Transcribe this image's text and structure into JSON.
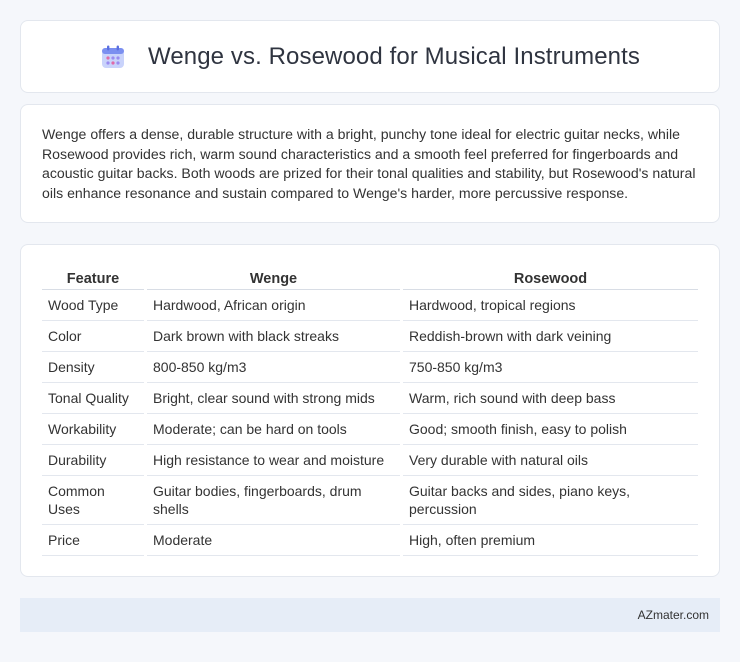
{
  "header": {
    "title": "Wenge vs. Rosewood for Musical Instruments",
    "icon": "calendar-icon"
  },
  "intro": {
    "text": "Wenge offers a dense, durable structure with a bright, punchy tone ideal for electric guitar necks, while Rosewood provides rich, warm sound characteristics and a smooth feel preferred for fingerboards and acoustic guitar backs. Both woods are prized for their tonal qualities and stability, but Rosewood's natural oils enhance resonance and sustain compared to Wenge's harder, more percussive response."
  },
  "table": {
    "headers": [
      "Feature",
      "Wenge",
      "Rosewood"
    ],
    "rows": [
      [
        "Wood Type",
        "Hardwood, African origin",
        "Hardwood, tropical regions"
      ],
      [
        "Color",
        "Dark brown with black streaks",
        "Reddish-brown with dark veining"
      ],
      [
        "Density",
        "800-850 kg/m3",
        "750-850 kg/m3"
      ],
      [
        "Tonal Quality",
        "Bright, clear sound with strong mids",
        "Warm, rich sound with deep bass"
      ],
      [
        "Workability",
        "Moderate; can be hard on tools",
        "Good; smooth finish, easy to polish"
      ],
      [
        "Durability",
        "High resistance to wear and moisture",
        "Very durable with natural oils"
      ],
      [
        "Common Uses",
        "Guitar bodies, fingerboards, drum shells",
        "Guitar backs and sides, piano keys, percussion"
      ],
      [
        "Price",
        "Moderate",
        "High, often premium"
      ]
    ]
  },
  "footer": {
    "brand": "AZmater.com"
  },
  "colors": {
    "background": "#f5f7fb",
    "card": "#ffffff",
    "footer": "#e6edf7",
    "icon_accent": "#7b8ff0"
  }
}
